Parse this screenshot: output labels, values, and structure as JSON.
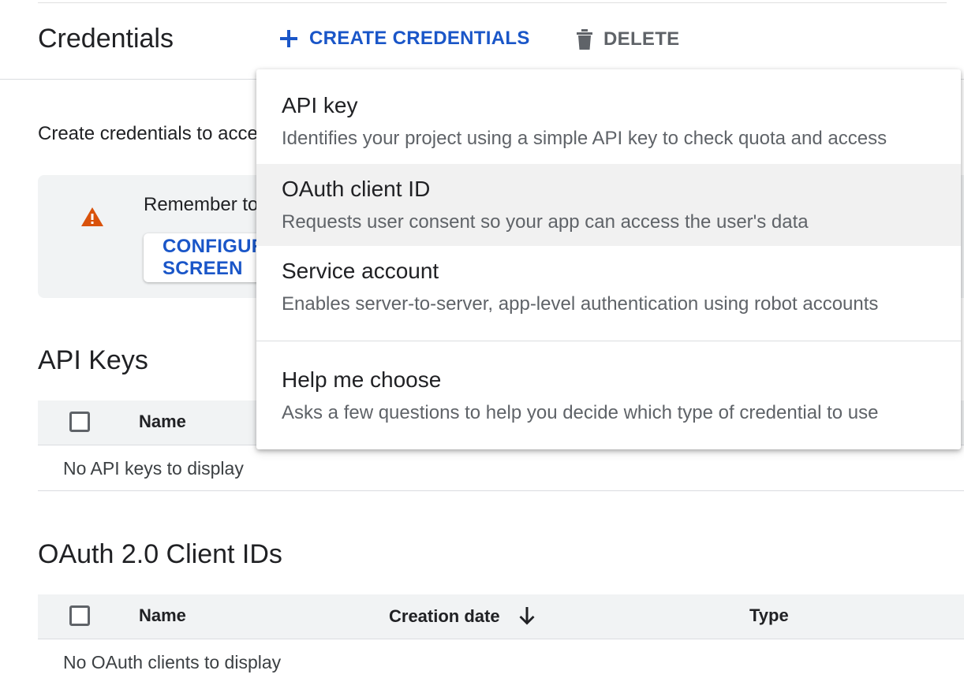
{
  "header": {
    "title": "Credentials",
    "create_label": "CREATE CREDENTIALS",
    "delete_label": "DELETE"
  },
  "intro": "Create credentials to access your enabled APIs",
  "notice": {
    "text": "Remember to configure the OAuth consent screen",
    "button_label": "CONFIGURE CONSENT SCREEN"
  },
  "api_keys": {
    "title": "API Keys",
    "columns": [
      "Name"
    ],
    "empty": "No API keys to display"
  },
  "oauth": {
    "title": "OAuth 2.0 Client IDs",
    "columns": [
      "Name",
      "Creation date",
      "Type"
    ],
    "empty": "No OAuth clients to display"
  },
  "menu": {
    "items": [
      {
        "title": "API key",
        "desc": "Identifies your project using a simple API key to check quota and access"
      },
      {
        "title": "OAuth client ID",
        "desc": "Requests user consent so your app can access the user's data"
      },
      {
        "title": "Service account",
        "desc": "Enables server-to-server, app-level authentication using robot accounts"
      },
      {
        "title": "Help me choose",
        "desc": "Asks a few questions to help you decide which type of credential to use"
      }
    ]
  },
  "colors": {
    "accent": "#1a56c8",
    "warning": "#d9520b",
    "muted": "#5f6368"
  },
  "icons": [
    "plus-icon",
    "trash-icon",
    "warning-icon",
    "arrow-down-icon"
  ]
}
